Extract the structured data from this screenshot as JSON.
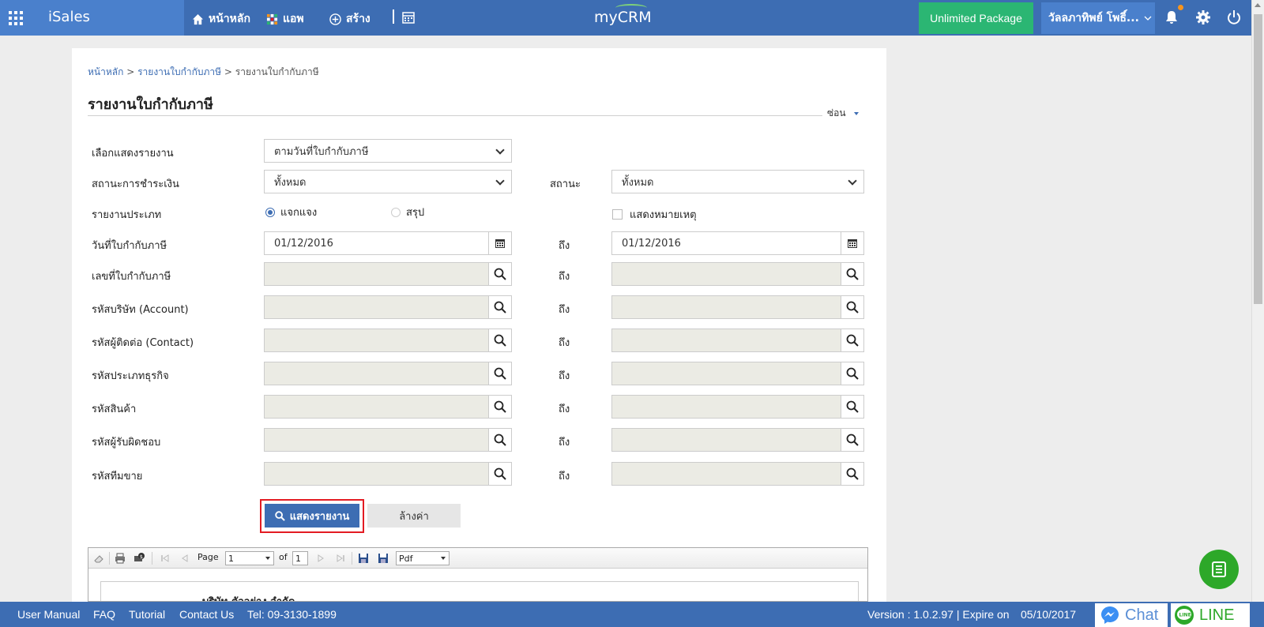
{
  "topbar": {
    "brand": "iSales",
    "nav": {
      "home": "หน้าหลัก",
      "apps": "แอพ",
      "create": "สร้าง"
    },
    "logo": "myCRM",
    "package_label": "Unlimited Package",
    "user_name": "วัลลภาทิพย์ โพธิ์...",
    "colors": {
      "bar": "#3d6db3",
      "package": "#2bb673",
      "notif_dot": "#f7941d"
    }
  },
  "breadcrumb": {
    "home": "หน้าหลัก",
    "sep": ">",
    "parent": "รายงานใบกำกับภาษี",
    "current": "รายงานใบกำกับภาษี"
  },
  "page": {
    "title": "รายงานใบกำกับภาษี",
    "hide_label": "ซ่อน"
  },
  "form": {
    "report_view_label": "เลือกแสดงรายงาน",
    "report_view_value": "ตามวันที่ใบกำกับภาษี",
    "payment_status_label": "สถานะการชำระเงิน",
    "payment_status_value": "ทั้งหมด",
    "status_label": "สถานะ",
    "status_value": "ทั้งหมด",
    "report_type_label": "รายงานประเภท",
    "radio_detail": "แจกแจง",
    "radio_summary": "สรุป",
    "show_remark": "แสดงหมายเหตุ",
    "date_label": "วันที่ใบกำกับภาษี",
    "date_from": "01/12/2016",
    "date_to": "01/12/2016",
    "to_label": "ถึง",
    "rows": [
      {
        "label": "เลขที่ใบกำกับภาษี"
      },
      {
        "label": "รหัสบริษัท (Account)"
      },
      {
        "label": "รหัสผู้ติดต่อ (Contact)"
      },
      {
        "label": "รหัสประเภทธุรกิจ"
      },
      {
        "label": "รหัสสินค้า"
      },
      {
        "label": "รหัสผู้รับผิดชอบ"
      },
      {
        "label": "รหัสทีมขาย"
      }
    ],
    "show_report_button": "แสดงรายงาน",
    "clear_button": "ล้างค่า"
  },
  "viewer": {
    "page_label": "Page",
    "page_value": "1",
    "of_label": "of",
    "total_pages": "1",
    "format_value": "Pdf",
    "page_preview_text": "บริษัท ตัวอย่าง จำกัด"
  },
  "footer": {
    "links": [
      "User Manual",
      "FAQ",
      "Tutorial",
      "Contact Us"
    ],
    "tel": "Tel: 09-3130-1899",
    "version": "Version : 1.0.2.97 | Expire on",
    "expire_date": "05/10/2017",
    "chat_label": "Chat",
    "line_label": "LINE"
  }
}
